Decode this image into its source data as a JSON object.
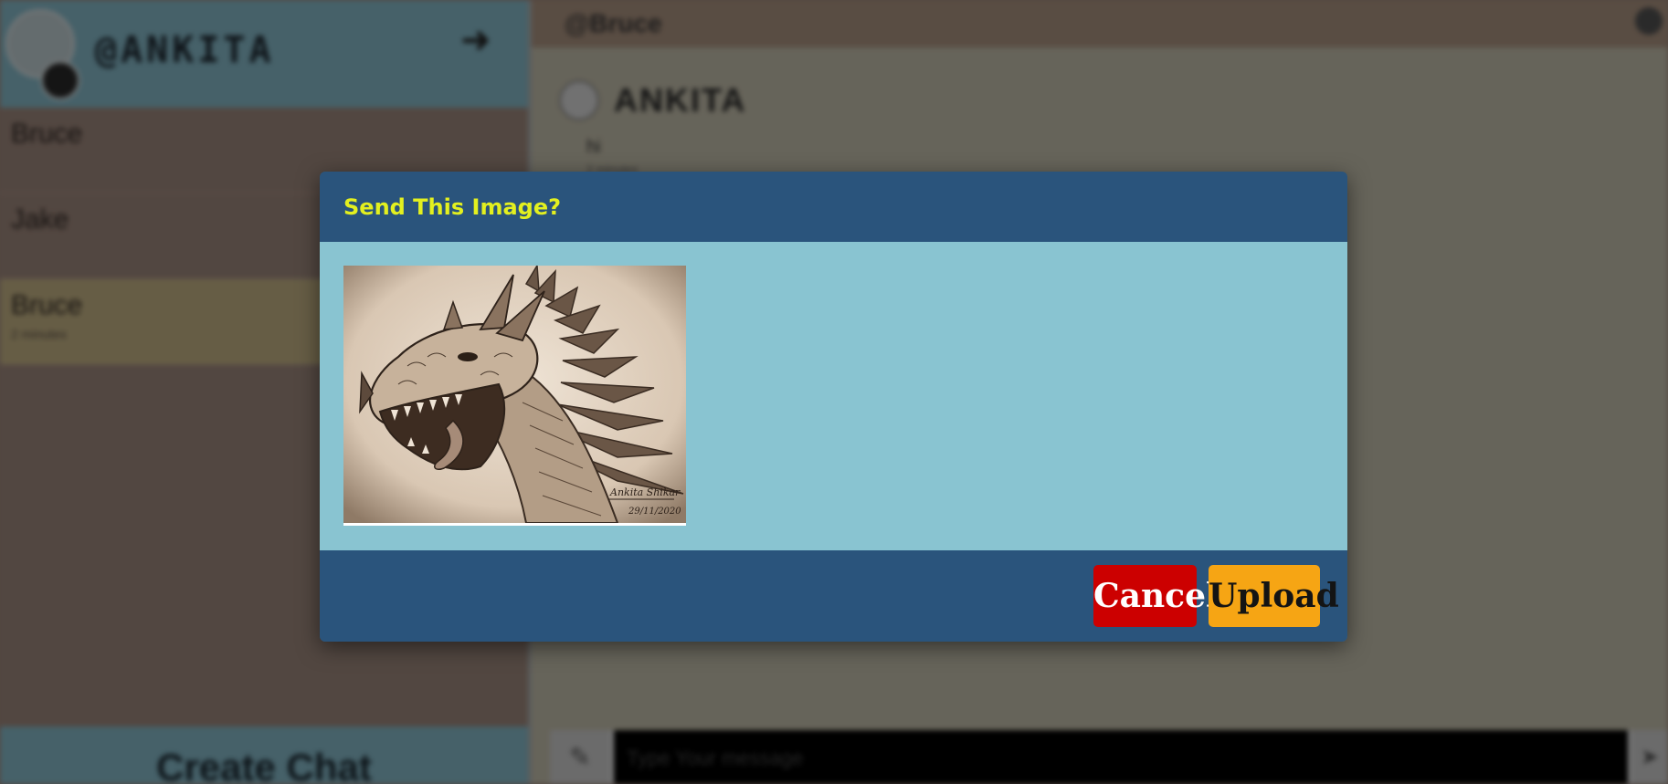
{
  "sidebar": {
    "username": "@ANKITA",
    "chats": [
      {
        "name": "Bruce",
        "sub": ""
      },
      {
        "name": "Jake",
        "sub": ""
      },
      {
        "name": "Bruce",
        "sub": "2 minutes"
      }
    ],
    "create_chat_label": "Create Chat"
  },
  "main": {
    "header_title": "@Bruce",
    "message": {
      "author": "ANKITA",
      "text": "hi",
      "time": "2 minutes"
    },
    "composer_placeholder": "Type Your message"
  },
  "modal": {
    "title": "Send This Image?",
    "image_alt": "Dragon sketch",
    "image_signature": "Ankita Shikar",
    "image_date": "29/11/2020",
    "cancel_label": "Cancel",
    "upload_label": "Upload"
  },
  "colors": {
    "modal_header": "#2a547c",
    "modal_body": "#89c4d1",
    "title_text": "#e3f01f",
    "cancel_button": "#cc0000",
    "upload_button": "#f6a514"
  }
}
